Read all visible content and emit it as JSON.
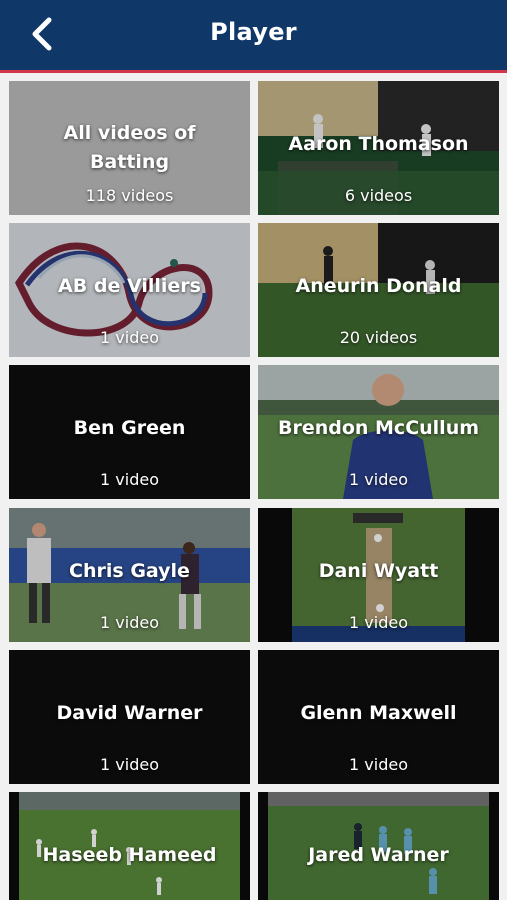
{
  "header": {
    "title": "Player",
    "back_icon": "chevron-left-icon",
    "background": "#0f3768",
    "accent_line": "#d0354a"
  },
  "tiles": [
    {
      "name": "All videos of Batting",
      "count": "118 videos"
    },
    {
      "name": "Aaron Thomason",
      "count": "6 videos"
    },
    {
      "name": "AB de Villiers",
      "count": "1 video"
    },
    {
      "name": "Aneurin Donald",
      "count": "20 videos"
    },
    {
      "name": "Ben Green",
      "count": "1 video"
    },
    {
      "name": "Brendon McCullum",
      "count": "1 video"
    },
    {
      "name": "Chris Gayle",
      "count": "1 video"
    },
    {
      "name": "Dani Wyatt",
      "count": "1 video"
    },
    {
      "name": "David Warner",
      "count": "1 video"
    },
    {
      "name": "Glenn Maxwell",
      "count": "1 video"
    },
    {
      "name": "Haseeb Hameed",
      "count": ""
    },
    {
      "name": "Jared Warner",
      "count": ""
    }
  ]
}
